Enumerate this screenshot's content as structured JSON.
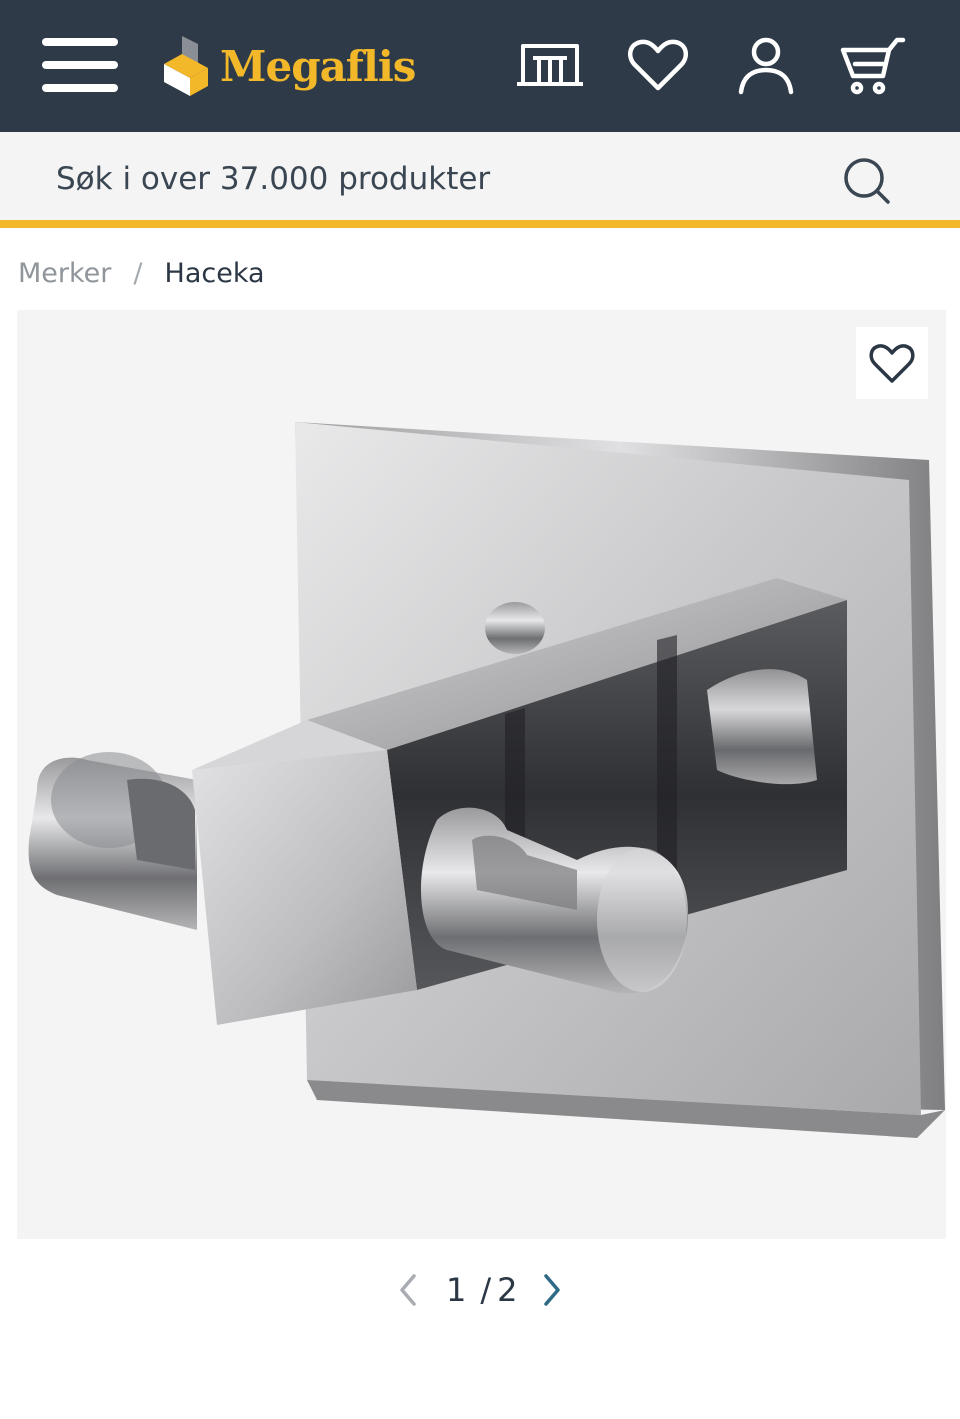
{
  "header": {
    "brand": "Megaflis",
    "colors": {
      "background": "#2f3a48",
      "accent": "#f2b829"
    },
    "icons": [
      "menu-icon",
      "store-icon",
      "heart-icon",
      "user-icon",
      "cart-icon"
    ]
  },
  "search": {
    "placeholder": "Søk i over 37.000 produkter",
    "value": ""
  },
  "breadcrumb": {
    "parent": "Merker",
    "separator": "/",
    "current": "Haceka"
  },
  "gallery": {
    "current": "1",
    "separator": "/",
    "total": "2"
  }
}
